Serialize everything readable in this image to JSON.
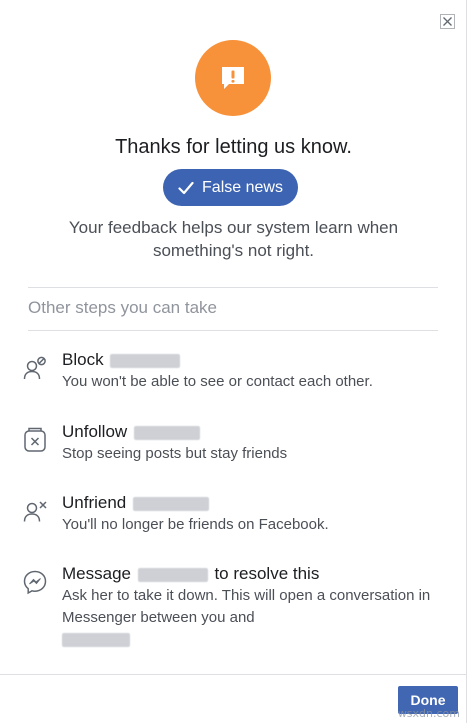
{
  "dialog": {
    "heading": "Thanks for letting us know.",
    "selected_reason": "False news",
    "feedback_line1": "Your feedback helps our system learn when",
    "feedback_line2": "something's not right.",
    "steps_title": "Other steps you can take",
    "done_label": "Done"
  },
  "steps": [
    {
      "title": "Block",
      "desc": "You won't be able to see or contact each other.",
      "icon": "block-user-icon"
    },
    {
      "title": "Unfollow",
      "desc": "Stop seeing posts but stay friends",
      "icon": "unfollow-icon"
    },
    {
      "title": "Unfriend",
      "desc": "You'll no longer be friends on Facebook.",
      "icon": "unfriend-icon"
    },
    {
      "title_prefix": "Message",
      "title_suffix": "to resolve this",
      "desc": "Ask her to take it down. This will open a conversation in Messenger between you and",
      "icon": "messenger-icon"
    }
  ],
  "watermark": "wsxdn.com",
  "colors": {
    "alert_orange": "#f7923a",
    "pill_blue": "#3c64b3",
    "button_blue": "#4267b2"
  }
}
